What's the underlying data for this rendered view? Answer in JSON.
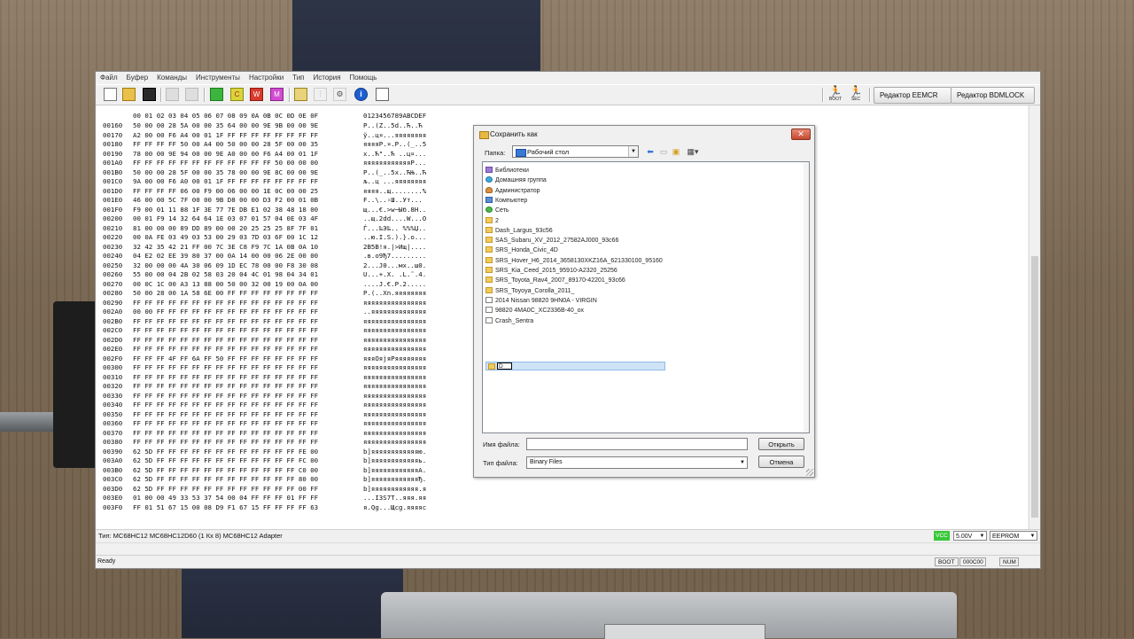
{
  "menu": [
    "Файл",
    "Буфер",
    "Команды",
    "Инструменты",
    "Настройки",
    "Тип",
    "История",
    "Помощь"
  ],
  "toolbar": {
    "boot_label": "BOOT",
    "sec_label": "SEC",
    "eemcr_button": "Редактор EEMCR",
    "bdmlock_button": "Редактор BDMLOCK"
  },
  "hex": {
    "header_bytes": "00 01 02 03 04 05 06 07 08 09 0A 0B 0C 0D 0E 0F",
    "header_ascii": "0123456789ABCDEF",
    "rows": [
      {
        "addr": "00160",
        "bytes": "50 00 00 28 5A 00 00 35 64 00 00 9E 9B 00 00 9E",
        "ascii": "P..(Z..5d..Ћ..Ћ"
      },
      {
        "addr": "00170",
        "bytes": "A2 00 00 F6 A4 00 01 1F FF FF FF FF FF FF FF FF",
        "ascii": "ў..ц¤...яяяяяяяя"
      },
      {
        "addr": "00180",
        "bytes": "FF FF FF FF 50 00 A4 00 50 00 00 28 5F 00 00 35",
        "ascii": "яяяяP.¤.P..(_..5"
      },
      {
        "addr": "00190",
        "bytes": "78 00 00 9E 94 00 00 9E A0 00 00 F6 A4 00 01 1F",
        "ascii": "x..Ћ\"..Ћ ..ц¤..."
      },
      {
        "addr": "001A0",
        "bytes": "FF FF FF FF FF FF FF FF FF FF FF FF 50 00 00 00",
        "ascii": "яяяяяяяяяяяяP..."
      },
      {
        "addr": "001B0",
        "bytes": "50 00 00 28 5F 00 00 35 78 00 00 9E 8C 00 00 9E",
        "ascii": "P..(_..5x..ЋЊ..Ћ"
      },
      {
        "addr": "001C0",
        "bytes": "9A 00 00 F6 A0 00 01 1F FF FF FF FF FF FF FF FF",
        "ascii": "љ..ц ...яяяяяяяя"
      },
      {
        "addr": "001D0",
        "bytes": "FF FF FF FF 06 00 F9 00 06 00 00 1E 0C 00 00 25",
        "ascii": "яяяя..щ........%"
      },
      {
        "addr": "001E0",
        "bytes": "46 00 00 5C 7F 00 00 9B D8 00 00 D3 F2 00 01 0B",
        "ascii": "F..\\..›Ш..Ут..."
      },
      {
        "addr": "001F0",
        "bytes": "F9 00 01 11 88 1F 3E 77 7E DB E1 02 38 48 18 00",
        "ascii": "щ...€.>w~Ыб.8H.."
      },
      {
        "addr": "00200",
        "bytes": "00 01 F9 14 32 64 64 1E 03 07 01 57 04 0E 03 4F",
        "ascii": "..щ.2dd....W...O"
      },
      {
        "addr": "00210",
        "bytes": "81 00 00 00 89 DD 89 00 00 20 25 25 25 8F 7F 01",
        "ascii": "Ѓ...‰Э‰.. %%%Џ.."
      },
      {
        "addr": "00220",
        "bytes": "00 0A FE 03 49 03 53 00 29 03 7D 03 6F 00 1C 12",
        "ascii": "..ю.I.S.).}.o..."
      },
      {
        "addr": "00230",
        "bytes": "32 42 35 42 21 FF 00 7C 3E C8 F9 7C 1A 0B 0A 10",
        "ascii": "2B5B!я.|>Ищ|...."
      },
      {
        "addr": "00240",
        "bytes": "04 E2 02 EE 39 80 37 00 0A 14 00 00 06 2E 00 00",
        "ascii": ".в.о9Ђ7........."
      },
      {
        "addr": "00250",
        "bytes": "32 00 00 00 4A 30 06 09 1D EC 78 00 00 F8 30 08",
        "ascii": "2...J0...мx..ш0."
      },
      {
        "addr": "00260",
        "bytes": "55 00 00 04 2B 02 58 03 20 04 4C 01 98 04 34 01",
        "ascii": "U...+.X. .L.˜.4."
      },
      {
        "addr": "00270",
        "bytes": "00 0C 1C 00 A3 13 88 00 50 00 32 00 19 00 0A 00",
        "ascii": "....Ј.€.P.2....."
      },
      {
        "addr": "00280",
        "bytes": "50 00 28 00 1A 58 6E 00 FF FF FF FF FF FF FF FF",
        "ascii": "P.(..Xn.яяяяяяяя"
      },
      {
        "addr": "00290",
        "bytes": "FF FF FF FF FF FF FF FF FF FF FF FF FF FF FF FF",
        "ascii": "яяяяяяяяяяяяяяяя"
      },
      {
        "addr": "002A0",
        "bytes": "00 00 FF FF FF FF FF FF FF FF FF FF FF FF FF FF",
        "ascii": "..яяяяяяяяяяяяяя"
      },
      {
        "addr": "002B0",
        "bytes": "FF FF FF FF FF FF FF FF FF FF FF FF FF FF FF FF",
        "ascii": "яяяяяяяяяяяяяяяя"
      },
      {
        "addr": "002C0",
        "bytes": "FF FF FF FF FF FF FF FF FF FF FF FF FF FF FF FF",
        "ascii": "яяяяяяяяяяяяяяяя"
      },
      {
        "addr": "002D0",
        "bytes": "FF FF FF FF FF FF FF FF FF FF FF FF FF FF FF FF",
        "ascii": "яяяяяяяяяяяяяяяя"
      },
      {
        "addr": "002E0",
        "bytes": "FF FF FF FF FF FF FF FF FF FF FF FF FF FF FF FF",
        "ascii": "яяяяяяяяяяяяяяяя"
      },
      {
        "addr": "002F0",
        "bytes": "FF FF FF 4F FF 6A FF 50 FF FF FF FF FF FF FF FF",
        "ascii": "яяяOяjяPяяяяяяяя"
      },
      {
        "addr": "00300",
        "bytes": "FF FF FF FF FF FF FF FF FF FF FF FF FF FF FF FF",
        "ascii": "яяяяяяяяяяяяяяяя"
      },
      {
        "addr": "00310",
        "bytes": "FF FF FF FF FF FF FF FF FF FF FF FF FF FF FF FF",
        "ascii": "яяяяяяяяяяяяяяяя"
      },
      {
        "addr": "00320",
        "bytes": "FF FF FF FF FF FF FF FF FF FF FF FF FF FF FF FF",
        "ascii": "яяяяяяяяяяяяяяяя"
      },
      {
        "addr": "00330",
        "bytes": "FF FF FF FF FF FF FF FF FF FF FF FF FF FF FF FF",
        "ascii": "яяяяяяяяяяяяяяяя"
      },
      {
        "addr": "00340",
        "bytes": "FF FF FF FF FF FF FF FF FF FF FF FF FF FF FF FF",
        "ascii": "яяяяяяяяяяяяяяяя"
      },
      {
        "addr": "00350",
        "bytes": "FF FF FF FF FF FF FF FF FF FF FF FF FF FF FF FF",
        "ascii": "яяяяяяяяяяяяяяяя"
      },
      {
        "addr": "00360",
        "bytes": "FF FF FF FF FF FF FF FF FF FF FF FF FF FF FF FF",
        "ascii": "яяяяяяяяяяяяяяяя"
      },
      {
        "addr": "00370",
        "bytes": "FF FF FF FF FF FF FF FF FF FF FF FF FF FF FF FF",
        "ascii": "яяяяяяяяяяяяяяяя"
      },
      {
        "addr": "00380",
        "bytes": "FF FF FF FF FF FF FF FF FF FF FF FF FF FF FF FF",
        "ascii": "яяяяяяяяяяяяяяяя"
      },
      {
        "addr": "00390",
        "bytes": "62 5D FF FF FF FF FF FF FF FF FF FF FF FF FE 00",
        "ascii": "b]яяяяяяяяяяяяю."
      },
      {
        "addr": "003A0",
        "bytes": "62 5D FF FF FF FF FF FF FF FF FF FF FF FF FC 00",
        "ascii": "b]яяяяяяяяяяяяь."
      },
      {
        "addr": "003B0",
        "bytes": "62 5D FF FF FF FF FF FF FF FF FF FF FF FF C0 00",
        "ascii": "b]яяяяяяяяяяяяА."
      },
      {
        "addr": "003C0",
        "bytes": "62 5D FF FF FF FF FF FF FF FF FF FF FF FF 80 00",
        "ascii": "b]яяяяяяяяяяяяЂ."
      },
      {
        "addr": "003D0",
        "bytes": "62 5D FF FF FF FF FF FF FF FF FF FF FF FF 00 FF",
        "ascii": "b]яяяяяяяяяяяя.я"
      },
      {
        "addr": "003E0",
        "bytes": "01 00 00 49 33 53 37 54 00 04 FF FF FF 01 FF FF",
        "ascii": "...I3S7T..яяя.яя"
      },
      {
        "addr": "003F0",
        "bytes": "FF 01 51 67 15 00 08 D9 F1 67 15 FF FF FF FF 63",
        "ascii": "я.Qg...Щсg.яяяяc"
      }
    ]
  },
  "infobar": {
    "type_text": "Тип: MC68HC12 MC68HC12D60 (1 Кх 8)   MC68HC12 Adapter",
    "vcc_label": "VCC",
    "voltage": "5.00V",
    "memory": "EEPROM"
  },
  "statusbar": {
    "ready": "Ready",
    "boot": "BOOT",
    "address": "000C00",
    "num": "NUM"
  },
  "dialog": {
    "title": "Сохранить как",
    "folder_label": "Папка:",
    "folder_value": "Рабочий стол",
    "items": [
      {
        "name": "Библиотеки",
        "icon": "lib"
      },
      {
        "name": "Домашняя группа",
        "icon": "home"
      },
      {
        "name": "Администратор",
        "icon": "user"
      },
      {
        "name": "Компьютер",
        "icon": "pc"
      },
      {
        "name": "Сеть",
        "icon": "net"
      },
      {
        "name": "2",
        "icon": "folder"
      },
      {
        "name": "Dash_Largus_93c56",
        "icon": "folder"
      },
      {
        "name": "SAS_Subaru_XV_2012_27582AJ000_93c66",
        "icon": "folder"
      },
      {
        "name": "SRS_Honda_Civic_4D",
        "icon": "folder"
      },
      {
        "name": "SRS_Hover_H6_2014_3658130XKZ16A_621330100_95160",
        "icon": "folder"
      },
      {
        "name": "SRS_Kia_Ceed_2015_95910-A2320_25256",
        "icon": "folder"
      },
      {
        "name": "SRS_Toyota_Rav4_2007_89170-42201_93c66",
        "icon": "folder"
      },
      {
        "name": "SRS_Toyoya_Corolla_2011_",
        "icon": "folder"
      },
      {
        "name": "2014 Nissan  98820 9HN0A - VIRGIN",
        "icon": "file"
      },
      {
        "name": "98820 4MA0C_XC2336B-40_ox",
        "icon": "file"
      },
      {
        "name": "Crash_Sentra",
        "icon": "file"
      }
    ],
    "new_folder_edit": "D",
    "filename_label": "Имя файла:",
    "filename_value": "",
    "filetype_label": "Тип файла:",
    "filetype_value": "Binary Files",
    "open_button": "Открыть",
    "cancel_button": "Отмена"
  }
}
